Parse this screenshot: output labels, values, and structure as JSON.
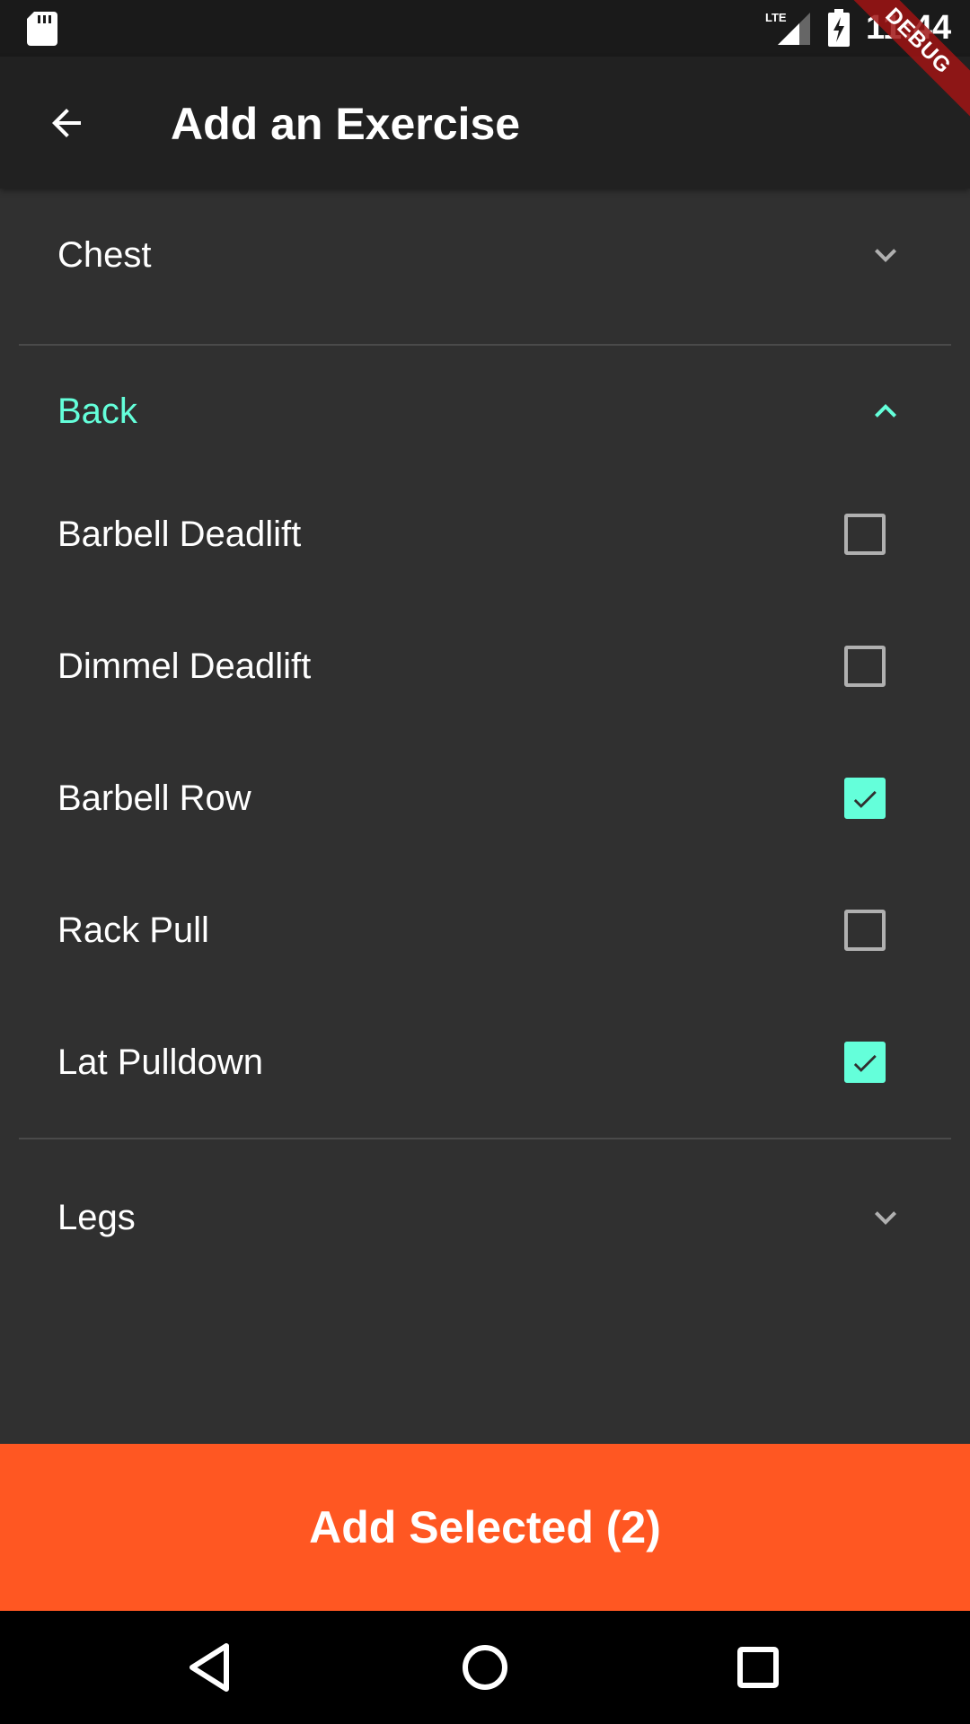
{
  "status_bar": {
    "time": "11:44",
    "icons": [
      "sd-card-icon",
      "lte-signal-icon",
      "battery-charging-icon"
    ],
    "network_label": "LTE"
  },
  "debug_banner": {
    "label": "DEBUG"
  },
  "app_bar": {
    "back_icon": "arrow-back-icon",
    "title": "Add an Exercise"
  },
  "categories": [
    {
      "label": "Chest",
      "expanded": false
    },
    {
      "label": "Back",
      "expanded": true,
      "exercises": [
        {
          "label": "Barbell Deadlift",
          "checked": false
        },
        {
          "label": "Dimmel Deadlift",
          "checked": false
        },
        {
          "label": "Barbell Row",
          "checked": true
        },
        {
          "label": "Rack Pull",
          "checked": false
        },
        {
          "label": "Lat Pulldown",
          "checked": true
        }
      ]
    },
    {
      "label": "Legs",
      "expanded": false
    }
  ],
  "add_button": {
    "label": "Add Selected (2)"
  },
  "nav_bar": {
    "buttons": [
      "back-triangle-icon",
      "home-circle-icon",
      "recents-square-icon"
    ]
  },
  "colors": {
    "accent": "#64ffda",
    "action": "#ff5722",
    "app_bar": "#212121",
    "background": "#303030"
  }
}
